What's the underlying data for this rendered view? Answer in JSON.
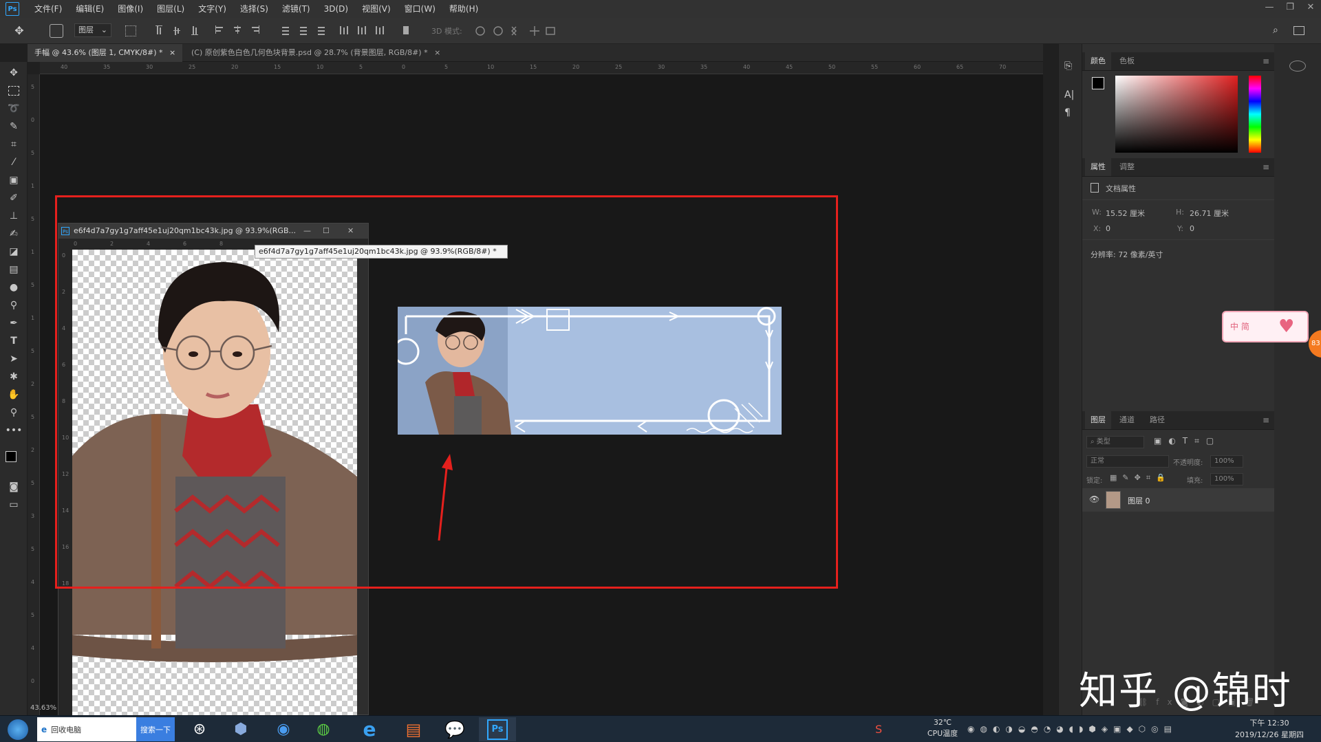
{
  "menubar": {
    "app_logo": "Ps",
    "items": [
      "文件(F)",
      "编辑(E)",
      "图像(I)",
      "图层(L)",
      "文字(Y)",
      "选择(S)",
      "滤镜(T)",
      "3D(D)",
      "视图(V)",
      "窗口(W)",
      "帮助(H)"
    ]
  },
  "options_bar": {
    "layer_select": "图层",
    "mode_3d_label": "3D 模式:"
  },
  "tabs": [
    {
      "label": "手幅 @ 43.6% (图层 1, CMYK/8#) *",
      "close": "×"
    },
    {
      "label": "(C) 原创紫色白色几何色块背景.psd @ 28.7% (背景图层, RGB/8#) *",
      "close": "×"
    }
  ],
  "ruler": {
    "h_labels": [
      "40",
      "35",
      "30",
      "25",
      "20",
      "15",
      "10",
      "5",
      "0",
      "5",
      "10",
      "15",
      "20",
      "25",
      "30",
      "35",
      "40",
      "45",
      "50",
      "55",
      "60",
      "65",
      "70"
    ],
    "v_labels": [
      "5",
      "0",
      "5",
      "1",
      "5",
      "1",
      "5",
      "1",
      "5",
      "2",
      "5",
      "2",
      "5",
      "3",
      "5",
      "4",
      "5",
      "4",
      "0"
    ]
  },
  "floating_window": {
    "title": "e6f4d7a7gy1g7aff45e1uj20qm1bc43k.jpg @ 93.9%(RGB...",
    "tooltip": "e6f4d7a7gy1g7aff45e1uj20qm1bc43k.jpg @ 93.9%(RGB/8#) *",
    "h_ruler": [
      "0",
      "2",
      "4",
      "6",
      "8"
    ],
    "v_ruler": [
      "0",
      "2",
      "4",
      "6",
      "8",
      "10",
      "12",
      "14",
      "16",
      "18"
    ]
  },
  "color_panel": {
    "tabs": [
      "颜色",
      "色板"
    ]
  },
  "properties_panel": {
    "tabs": [
      "属性",
      "调整"
    ],
    "section": "文档属性",
    "width_label": "W:",
    "width_value": "15.52 厘米",
    "height_label": "H:",
    "height_value": "26.71 厘米",
    "x_label": "X:",
    "x_value": "0",
    "y_label": "Y:",
    "y_value": "0",
    "resolution": "分辨率: 72 像素/英寸"
  },
  "layers_panel": {
    "tabs": [
      "图层",
      "通道",
      "路径"
    ],
    "filter": "类型",
    "blend_mode": "正常",
    "opacity_label": "不透明度:",
    "opacity_value": "100%",
    "lock_label": "锁定:",
    "fill_label": "填充:",
    "fill_value": "100%",
    "layers": [
      {
        "name": "图层 0"
      }
    ]
  },
  "status": {
    "zoom": "43.63%"
  },
  "taskbar": {
    "ie_label": "回收电脑",
    "search_button": "搜索一下",
    "temperature": "32℃",
    "cpu_label": "CPU温度",
    "time": "下午 12:30",
    "date": "2019/12/26 星期四"
  },
  "sticker_text": "中 简",
  "badge_text": "83",
  "watermark": "知乎 @锦时",
  "colors": {
    "annotation_red": "#e5201d",
    "banner_blue": "#a8bfe0",
    "ps_blue": "#31a8ff"
  }
}
